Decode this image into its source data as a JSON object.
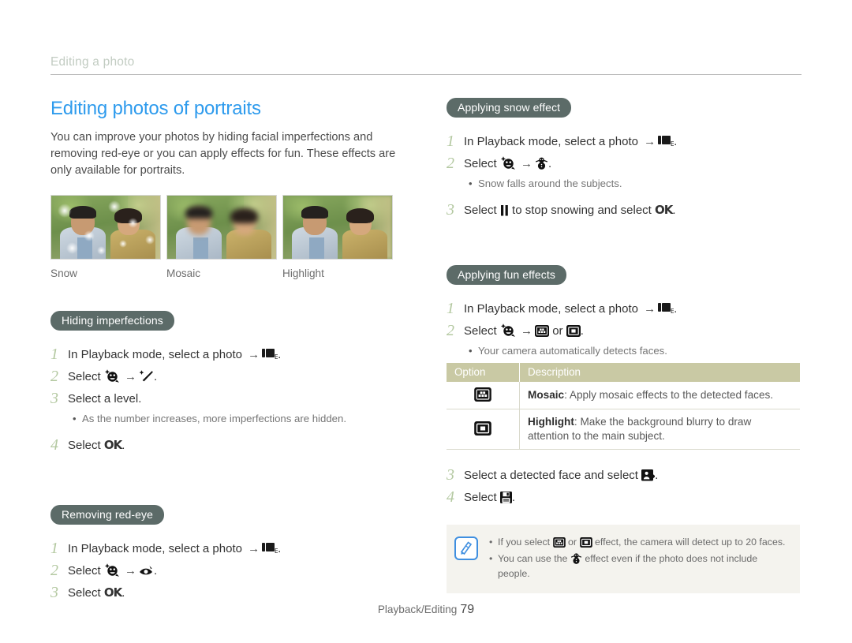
{
  "running_head": "Editing a photo",
  "title": "Editing photos of portraits",
  "intro": "You can improve your photos by hiding facial imperfections and removing red-eye or you can apply effects for fun. These effects are only available for portraits.",
  "samples": [
    {
      "caption": "Snow",
      "effect": "snow"
    },
    {
      "caption": "Mosaic",
      "effect": "mosaic"
    },
    {
      "caption": "Highlight",
      "effect": "highlight"
    }
  ],
  "sections": {
    "hiding": {
      "heading": "Hiding imperfections",
      "step1_pre": "In Playback mode, select a photo",
      "step1_icon": "photo-edit-icon",
      "step1_post": ".",
      "step2_pre": "Select",
      "step2_icon_a": "smart-face-icon",
      "step2_icon_b": "retouch-wand-icon",
      "step2_post": ".",
      "step3": "Select a level.",
      "step3_bullet": "As the number increases, more imperfections are hidden.",
      "step4_pre": "Select",
      "step4_ok": "OK",
      "step4_post": "."
    },
    "redeye": {
      "heading": "Removing red-eye",
      "step1_pre": "In Playback mode, select a photo",
      "step1_post": ".",
      "step2_pre": "Select",
      "step2_icon_a": "smart-face-icon",
      "step2_icon_b": "red-eye-icon",
      "step2_post": ".",
      "step3_pre": "Select",
      "step3_ok": "OK",
      "step3_post": "."
    },
    "snow": {
      "heading": "Applying snow effect",
      "step1_pre": "In Playback mode, select a photo",
      "step1_post": ".",
      "step2_pre": "Select",
      "step2_icon_a": "smart-face-icon",
      "step2_icon_b": "snowman-icon",
      "step2_post": ".",
      "step2_bullet": "Snow falls around the subjects.",
      "step3_pre": "Select",
      "step3_icon": "pause-icon",
      "step3_mid": "to stop snowing and select",
      "step3_ok": "OK",
      "step3_post": "."
    },
    "fun": {
      "heading": "Applying fun effects",
      "step1_pre": "In Playback mode, select a photo",
      "step1_post": ".",
      "step2_pre": "Select",
      "step2_icon_a": "smart-face-icon",
      "step2_icon_b": "mosaic-icon",
      "step2_or": "or",
      "step2_icon_c": "highlight-icon",
      "step2_post": ".",
      "step2_bullet": "Your camera automatically detects faces.",
      "table": {
        "headers": [
          "Option",
          "Description"
        ],
        "rows": [
          {
            "icon": "mosaic-icon",
            "name": "Mosaic",
            "desc": ": Apply mosaic effects to the detected faces."
          },
          {
            "icon": "highlight-icon",
            "name": "Highlight",
            "desc": ": Make the background blurry to draw attention to the main subject."
          }
        ]
      },
      "step3_pre": "Select a detected face and select",
      "step3_icon": "apply-face-icon",
      "step3_post": ".",
      "step4_pre": "Select",
      "step4_icon": "save-icon",
      "step4_post": "."
    }
  },
  "note": {
    "icon": "note-pen-icon",
    "items": [
      {
        "pre": "If you select",
        "icon_a": "mosaic-icon",
        "mid": "or",
        "icon_b": "highlight-icon",
        "post": "effect, the camera will detect up to 20 faces."
      },
      {
        "pre": "You can use the",
        "icon_a": "snowman-icon",
        "post": "effect even if the photo does not include people."
      }
    ]
  },
  "footer": {
    "label": "Playback/Editing",
    "page": "79"
  },
  "colors": {
    "title": "#2e9bed",
    "pill_bg": "#5c6b68",
    "step_number": "#b3c8a0",
    "table_header_bg": "#c9c9a4",
    "note_bg": "#f4f3ee",
    "note_icon_border": "#3f8fe0",
    "running_head": "#c2ccc2"
  }
}
